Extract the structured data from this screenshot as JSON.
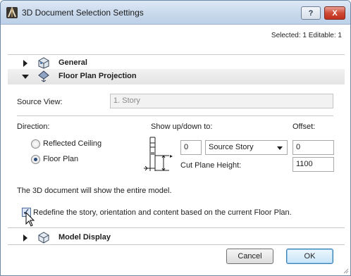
{
  "window": {
    "title": "3D Document Selection Settings"
  },
  "titlebar": {
    "help_label": "?",
    "close_label": "X"
  },
  "status": {
    "selected": "Selected: 1 Editable: 1"
  },
  "sections": {
    "general": "General",
    "floor_plan_projection": "Floor Plan Projection",
    "model_display": "Model Display"
  },
  "source_view": {
    "label": "Source View:",
    "value": "1. Story"
  },
  "direction": {
    "label": "Direction:",
    "options": [
      "Reflected Ceiling",
      "Floor Plan"
    ],
    "selected": "Floor Plan"
  },
  "show_updown": {
    "label": "Show up/down to:",
    "value": "0",
    "select_value": "Source Story",
    "cut_plane_label": "Cut Plane Height:"
  },
  "offset": {
    "label": "Offset:",
    "value": "0",
    "cut_plane_value": "1100"
  },
  "info_text": "The 3D document will show the entire model.",
  "redefine": {
    "label": "Redefine the story, orientation and content based on the current Floor Plan.",
    "checked": true
  },
  "buttons": {
    "cancel": "Cancel",
    "ok": "OK"
  },
  "icons": {
    "app": "archicad-icon",
    "general": "general-settings-icon",
    "floor_plan": "floor-plan-projection-icon",
    "model_display": "model-display-icon",
    "height_diagram": "section-height-diagram-icon"
  }
}
